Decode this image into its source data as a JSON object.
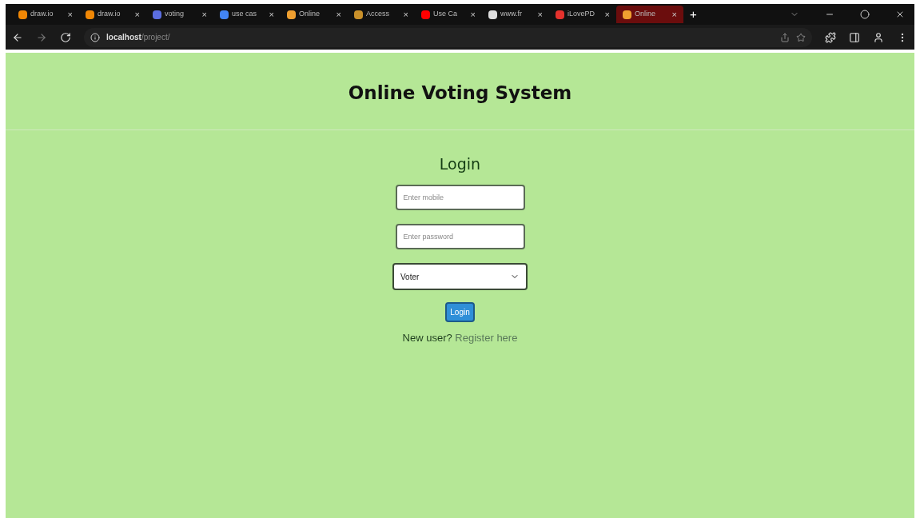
{
  "browser": {
    "tabs": [
      {
        "title": "draw.io",
        "color": "#f08705",
        "selected": false
      },
      {
        "title": "draw.io",
        "color": "#f08705",
        "selected": false
      },
      {
        "title": "voting",
        "color": "#5b6ee1",
        "selected": false
      },
      {
        "title": "use cas",
        "color": "#4285f4",
        "selected": false
      },
      {
        "title": "Online",
        "color": "#f0a030",
        "selected": false
      },
      {
        "title": "Access",
        "color": "#c8902a",
        "selected": false
      },
      {
        "title": "Use Ca",
        "color": "#ff0000",
        "selected": false
      },
      {
        "title": "www.fr",
        "color": "#dddddd",
        "selected": false
      },
      {
        "title": "iLovePD",
        "color": "#e5322d",
        "selected": false
      },
      {
        "title": "Online",
        "color": "#f0a030",
        "selected": true
      }
    ],
    "new_tab": "+",
    "close": "×",
    "url_host": "localhost",
    "url_path": "/project/"
  },
  "page": {
    "title": "Online Voting System",
    "form_title": "Login",
    "mobile": {
      "placeholder": "Enter mobile"
    },
    "password": {
      "placeholder": "Enter password"
    },
    "role": {
      "value": "Voter"
    },
    "button": "Login",
    "register_prompt": "New user?",
    "register_link": "Register here"
  }
}
